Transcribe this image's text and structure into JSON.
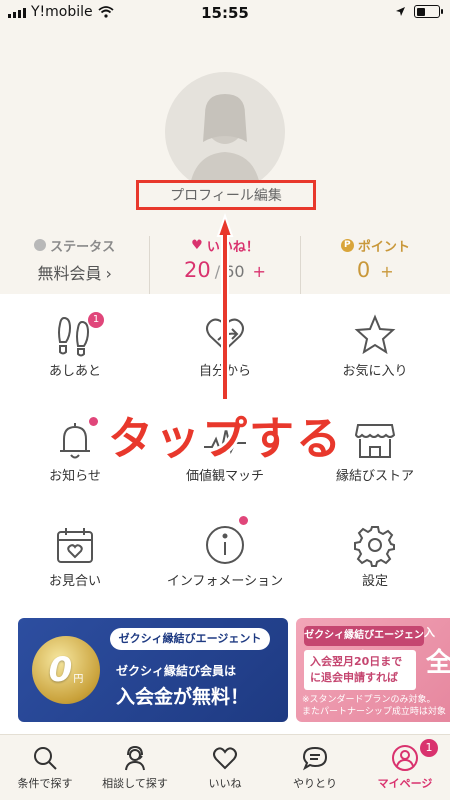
{
  "status_bar": {
    "carrier": "Y!mobile",
    "time": "15:55"
  },
  "profile": {
    "edit_label": "プロフィール編集"
  },
  "stats": {
    "status": {
      "label": "ステータス",
      "value": "無料会員",
      "chevron": "›"
    },
    "likes": {
      "label": "いいね！",
      "current": "20",
      "separator": "/",
      "max": "60",
      "plus": "+"
    },
    "points": {
      "label": "ポイント",
      "value": "0",
      "plus": "+",
      "icon_letter": "P"
    }
  },
  "menu": [
    {
      "label": "あしあと",
      "icon": "footprints-icon",
      "badge": "1"
    },
    {
      "label": "自分から",
      "icon": "heart-arrow-icon"
    },
    {
      "label": "お気に入り",
      "icon": "star-icon"
    },
    {
      "label": "お知らせ",
      "icon": "bell-icon",
      "dot": true
    },
    {
      "label": "価値観マッチ",
      "icon": "pulse-icon"
    },
    {
      "label": "縁結びストア",
      "icon": "store-icon"
    },
    {
      "label": "お見合い",
      "icon": "calendar-heart-icon"
    },
    {
      "label": "インフォメーション",
      "icon": "info-icon",
      "dot": true
    },
    {
      "label": "設定",
      "icon": "gear-icon"
    }
  ],
  "banners": {
    "primary": {
      "brand": "ゼクシィ縁結びエージェント",
      "zero": "0",
      "yen": "円",
      "line1": "ゼクシィ縁結び会員は",
      "line2": "入会金が無料！"
    },
    "secondary": {
      "brand": "ゼクシィ縁結びエージェント",
      "box_line1": "入会翌月20日まで",
      "box_line2": "に退会申請すれば",
      "note_line1": "※スタンダードプランのみ対象。",
      "note_line2": "またパートナーシップ成立時は対象",
      "side_small": "入",
      "side_big": "全"
    }
  },
  "tabs": [
    {
      "label": "条件で探す",
      "icon": "search-icon"
    },
    {
      "label": "相談して探す",
      "icon": "headset-person-icon"
    },
    {
      "label": "いいね",
      "icon": "heart-icon"
    },
    {
      "label": "やりとり",
      "icon": "chat-bubble-icon"
    },
    {
      "label": "マイページ",
      "icon": "user-circle-icon",
      "active": true,
      "badge": "1"
    }
  ],
  "annotation": {
    "text": "タップする",
    "color": "#e8382c"
  },
  "colors": {
    "accent_pink": "#d9326e",
    "gold": "#c9983a",
    "annotation_red": "#e8382c",
    "background_cream": "#f7f4ee"
  }
}
